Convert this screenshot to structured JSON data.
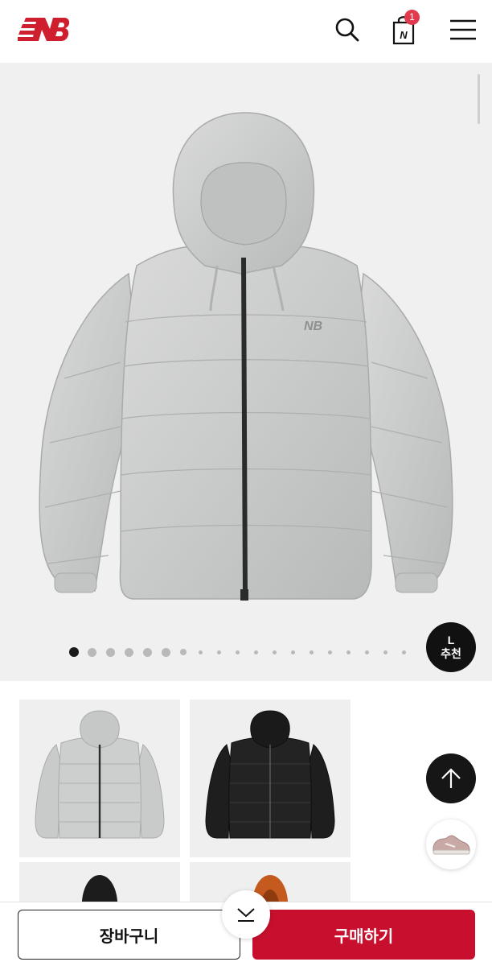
{
  "header": {
    "logo": "new-balance-logo",
    "cart_count": "1",
    "icons": [
      "search-icon",
      "shopping-bag-icon",
      "hamburger-menu-icon"
    ]
  },
  "gallery": {
    "total_images": 19,
    "active_index": 0,
    "size_badge": {
      "size": "L",
      "label": "추천"
    }
  },
  "thumbnails": [
    {
      "color_name": "light-gray"
    },
    {
      "color_name": "black"
    },
    {
      "color_name": "black"
    },
    {
      "color_name": "orange"
    }
  ],
  "floating": {
    "scroll_top_icon": "arrow-up-icon",
    "recent_item_icon": "sneaker-thumbnail"
  },
  "bottom_bar": {
    "cart_label": "장바구니",
    "buy_label": "구매하기",
    "collapse_icon": "chevron-down-icon"
  },
  "colors": {
    "brand_red": "#c8102e",
    "badge_red": "#e03a4c",
    "jacket_gray": "#c9cbca",
    "jacket_black": "#1b1b1b",
    "jacket_orange": "#c55a1e"
  }
}
